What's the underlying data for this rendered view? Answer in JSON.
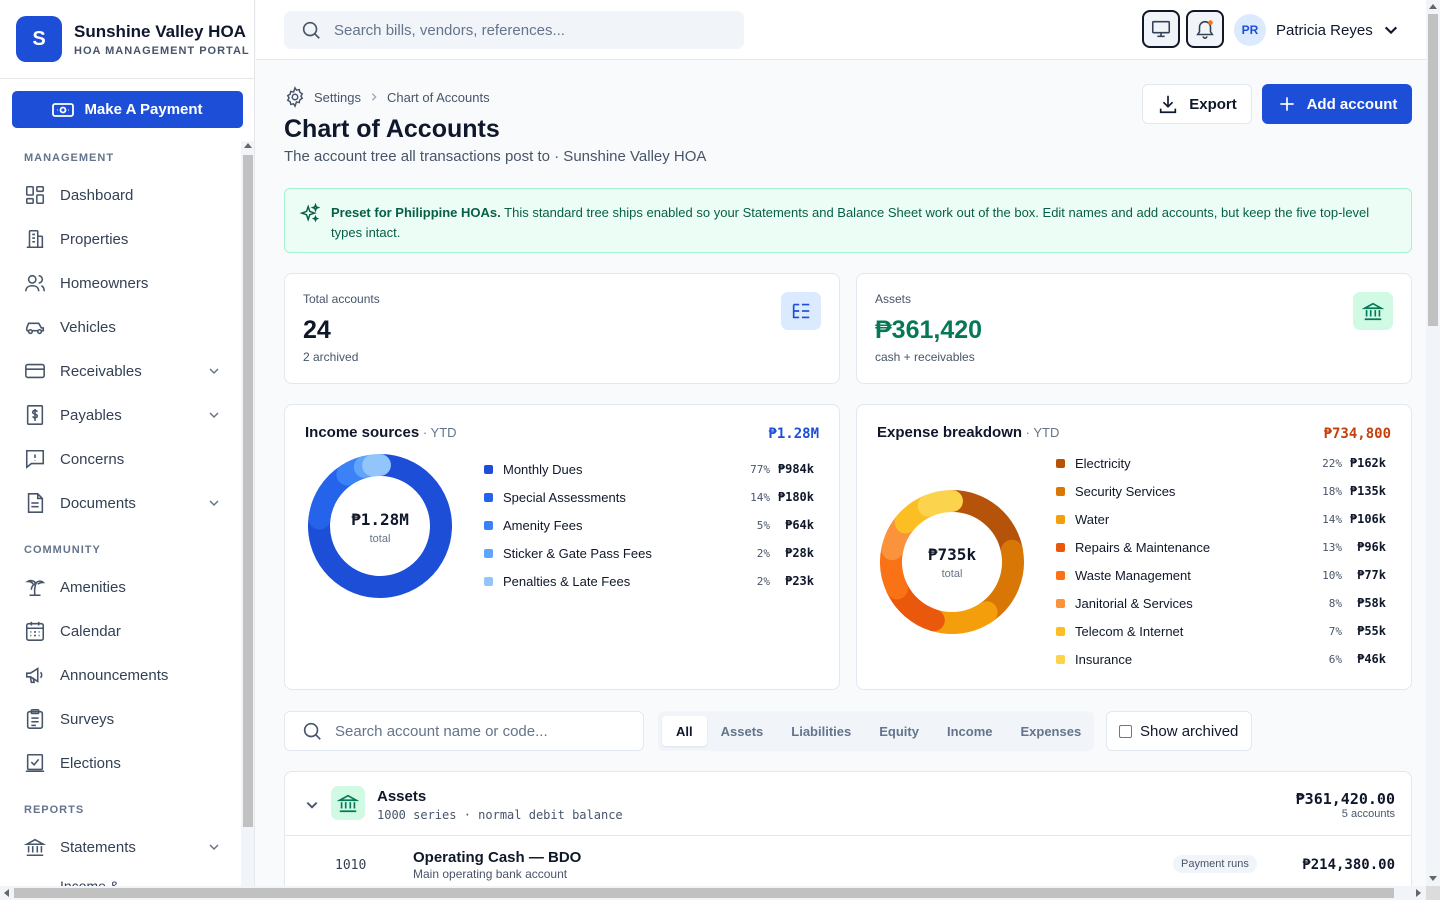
{
  "brand": {
    "logo_letter": "S",
    "name": "Sunshine Valley HOA",
    "subtitle": "HOA MANAGEMENT PORTAL"
  },
  "sidebar": {
    "pay_button": "Make A Payment",
    "sections": [
      {
        "title": "MANAGEMENT"
      },
      {
        "title": "COMMUNITY"
      },
      {
        "title": "REPORTS"
      }
    ],
    "items": [
      {
        "label": "Dashboard",
        "icon": "dashboard-icon"
      },
      {
        "label": "Properties",
        "icon": "building-icon"
      },
      {
        "label": "Homeowners",
        "icon": "users-icon"
      },
      {
        "label": "Vehicles",
        "icon": "car-icon"
      },
      {
        "label": "Receivables",
        "icon": "credit-card-icon",
        "expandable": true
      },
      {
        "label": "Payables",
        "icon": "dollar-file-icon",
        "expandable": true
      },
      {
        "label": "Concerns",
        "icon": "message-alert-icon"
      },
      {
        "label": "Documents",
        "icon": "document-icon",
        "expandable": true
      },
      {
        "label": "Amenities",
        "icon": "palm-tree-icon"
      },
      {
        "label": "Calendar",
        "icon": "calendar-icon"
      },
      {
        "label": "Announcements",
        "icon": "megaphone-icon"
      },
      {
        "label": "Surveys",
        "icon": "clipboard-icon"
      },
      {
        "label": "Elections",
        "icon": "vote-icon"
      },
      {
        "label": "Statements",
        "icon": "bank-icon",
        "expandable": true
      },
      {
        "label": "Income &",
        "icon": ""
      }
    ]
  },
  "topbar": {
    "search_placeholder": "Search bills, vendors, references...",
    "user": {
      "initials": "PR",
      "name": "Patricia Reyes"
    }
  },
  "page": {
    "breadcrumb": [
      "Settings",
      "Chart of Accounts"
    ],
    "title": "Chart of Accounts",
    "subtitle": "The account tree all transactions post to · Sunshine Valley HOA",
    "export_label": "Export",
    "add_label": "Add account"
  },
  "notice": {
    "bold": "Preset for Philippine HOAs.",
    "text": " This standard tree ships enabled so your Statements and Balance Sheet work out of the box. Edit names and add accounts, but keep the five top-level types intact."
  },
  "stats": {
    "total": {
      "label": "Total accounts",
      "value": "24",
      "sub": "2 archived"
    },
    "assets": {
      "label": "Assets",
      "value": "₱361,420",
      "sub": "cash + receivables"
    }
  },
  "income": {
    "title": "Income sources",
    "period": " · YTD",
    "total": "₱1.28M",
    "center_value": "₱1.28M",
    "center_label": "total",
    "items": [
      {
        "name": "Monthly Dues",
        "pct": "77%",
        "amount": "₱984k",
        "value": 984,
        "color": "#1d4ed8"
      },
      {
        "name": "Special Assessments",
        "pct": "14%",
        "amount": "₱180k",
        "value": 180,
        "color": "#2563eb"
      },
      {
        "name": "Amenity Fees",
        "pct": "5%",
        "amount": "₱64k",
        "value": 64,
        "color": "#3b82f6"
      },
      {
        "name": "Sticker & Gate Pass Fees",
        "pct": "2%",
        "amount": "₱28k",
        "value": 28,
        "color": "#60a5fa"
      },
      {
        "name": "Penalties & Late Fees",
        "pct": "2%",
        "amount": "₱23k",
        "value": 23,
        "color": "#93c5fd"
      }
    ]
  },
  "expense": {
    "title": "Expense breakdown",
    "period": " · YTD",
    "total": "₱734,800",
    "center_value": "₱735k",
    "center_label": "total",
    "items": [
      {
        "name": "Electricity",
        "pct": "22%",
        "amount": "₱162k",
        "value": 162,
        "color": "#b45309"
      },
      {
        "name": "Security Services",
        "pct": "18%",
        "amount": "₱135k",
        "value": 135,
        "color": "#d97706"
      },
      {
        "name": "Water",
        "pct": "14%",
        "amount": "₱106k",
        "value": 106,
        "color": "#f59e0b"
      },
      {
        "name": "Repairs & Maintenance",
        "pct": "13%",
        "amount": "₱96k",
        "value": 96,
        "color": "#ea580c"
      },
      {
        "name": "Waste Management",
        "pct": "10%",
        "amount": "₱77k",
        "value": 77,
        "color": "#f97316"
      },
      {
        "name": "Janitorial & Services",
        "pct": "8%",
        "amount": "₱58k",
        "value": 58,
        "color": "#fb923c"
      },
      {
        "name": "Telecom & Internet",
        "pct": "7%",
        "amount": "₱55k",
        "value": 55,
        "color": "#fbbf24"
      },
      {
        "name": "Insurance",
        "pct": "6%",
        "amount": "₱46k",
        "value": 46,
        "color": "#fcd34d"
      }
    ]
  },
  "filters": {
    "search_placeholder": "Search account name or code...",
    "tabs": [
      "All",
      "Assets",
      "Liabilities",
      "Equity",
      "Income",
      "Expenses"
    ],
    "active_tab": "All",
    "show_archived": "Show archived"
  },
  "tree": {
    "group": {
      "name": "Assets",
      "meta": "1000 series · normal debit balance",
      "total": "₱361,420.00",
      "count": "5 accounts"
    },
    "rows": [
      {
        "code": "1010",
        "name": "Operating Cash — BDO",
        "desc": "Main operating bank account",
        "tag": "Payment runs",
        "balance": "₱214,380.00"
      }
    ]
  },
  "colors": {
    "primary": "#1d4ed8",
    "success": "#047857",
    "expense_accent": "#c2410c"
  }
}
